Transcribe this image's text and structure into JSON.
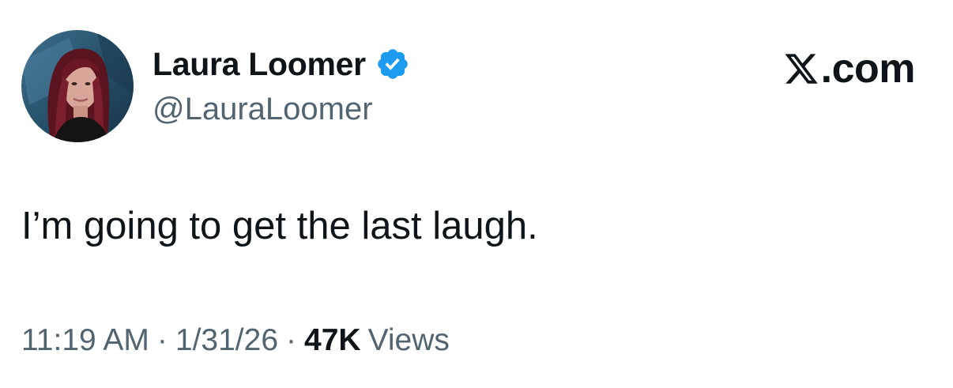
{
  "author": {
    "display_name": "Laura Loomer",
    "handle": "@LauraLoomer",
    "verified": true,
    "verified_badge_color": "#1d9bf0",
    "avatar_icon": "profile-photo"
  },
  "brand": {
    "label": ".com",
    "logo_icon": "x-logo-icon"
  },
  "tweet": {
    "text": "I’m going to get the last laugh."
  },
  "meta": {
    "time": "11:19 AM",
    "date": "1/31/26",
    "separator": "·",
    "views_count": "47K",
    "views_label": "Views"
  },
  "colors": {
    "text_primary": "#0f1419",
    "text_secondary": "#536471",
    "background": "#ffffff"
  }
}
